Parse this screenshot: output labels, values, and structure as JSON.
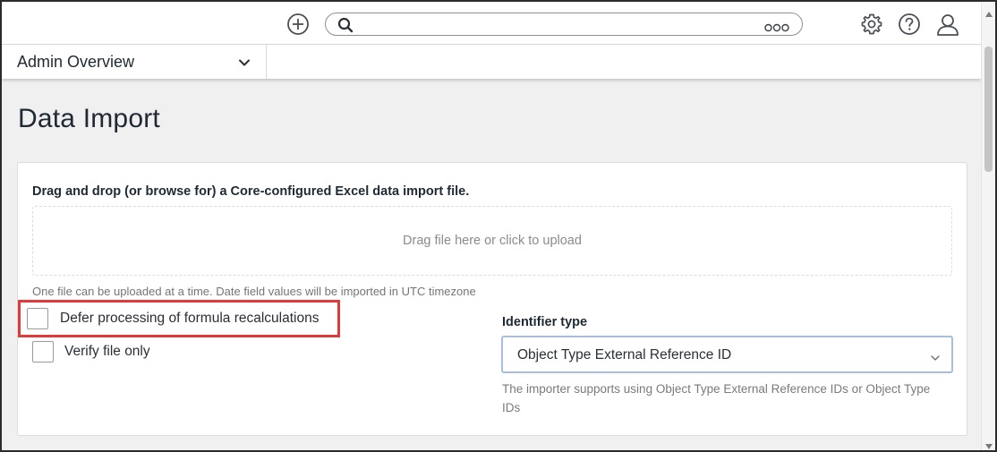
{
  "topbar": {
    "add_icon": "plus-circle-icon",
    "search": {
      "placeholder": "",
      "value": "",
      "icon": "search-icon",
      "more_icon": "ellipsis-icon"
    },
    "settings_icon": "gear-icon",
    "help_icon": "question-circle-icon",
    "user_icon": "user-icon"
  },
  "subnav": {
    "dashboard_label": "Admin Overview",
    "dropdown_icon": "chevron-down-icon"
  },
  "page": {
    "title": "Data Import"
  },
  "import_card": {
    "instruction": "Drag and drop (or browse for) a Core-configured Excel data import file.",
    "dropzone_text": "Drag file here or click to upload",
    "upload_hint": "One file can be uploaded at a time. Date field values will be imported in UTC timezone",
    "defer_checkbox": {
      "label": "Defer processing of formula recalculations",
      "checked": false
    },
    "verify_checkbox": {
      "label": "Verify file only",
      "checked": false
    },
    "identifier": {
      "label": "Identifier type",
      "selected": "Object Type External Reference ID",
      "help": "The importer supports using Object Type External Reference IDs or Object Type IDs"
    }
  },
  "colors": {
    "highlight": "#e03a3a",
    "select_border": "#a7bde6",
    "text": "#1f2933",
    "page_bg": "#f0f0f0"
  }
}
